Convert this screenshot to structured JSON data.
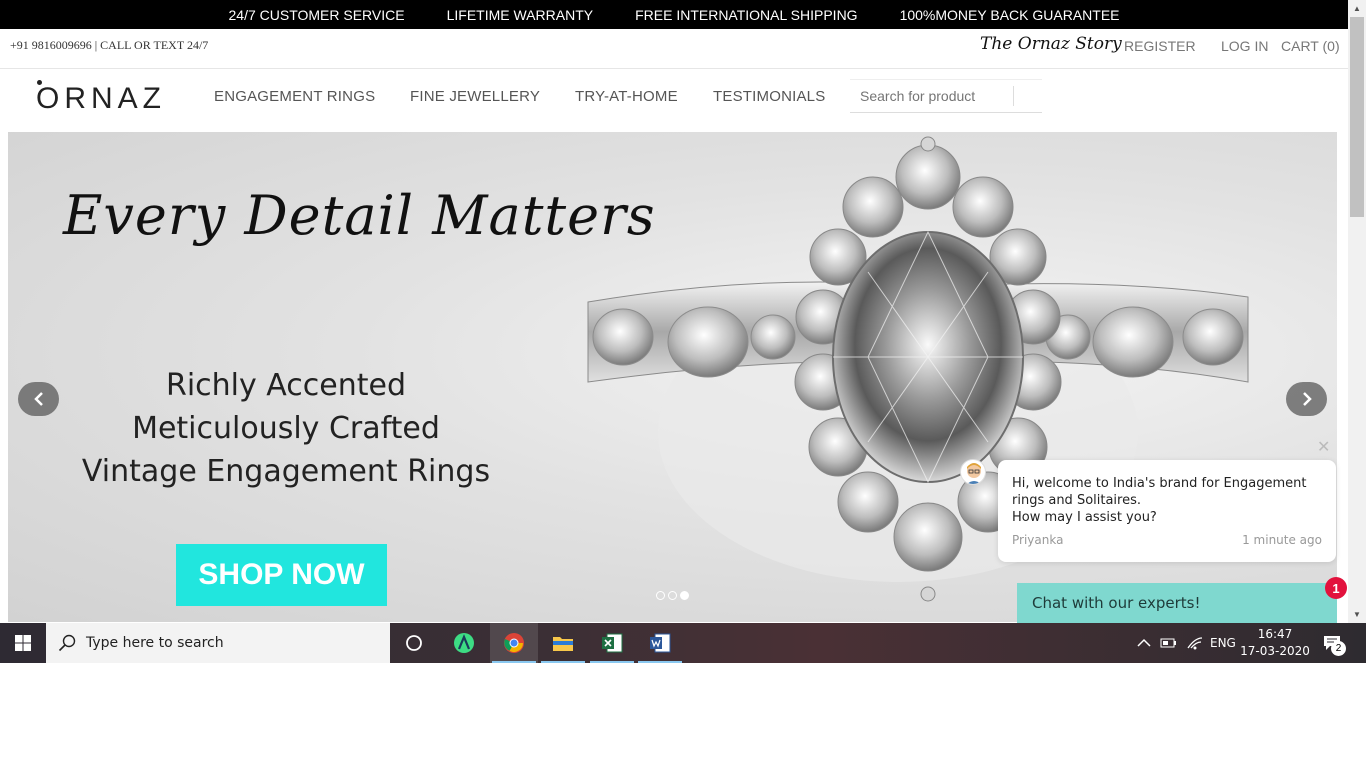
{
  "promo": {
    "items": [
      "24/7 CUSTOMER SERVICE",
      "LIFETIME WARRANTY",
      "FREE INTERNATIONAL SHIPPING",
      "100%MONEY BACK GUARANTEE"
    ]
  },
  "util": {
    "contact": "+91 9816009696 | CALL OR TEXT 24/7",
    "story": "The Ornaz Story",
    "register": "REGISTER",
    "login": "LOG IN",
    "cart": "CART (0)"
  },
  "nav": {
    "logo": "ORNAZ",
    "items": [
      "ENGAGEMENT RINGS",
      "FINE JEWELLERY",
      "TRY-AT-HOME",
      "TESTIMONIALS"
    ],
    "search_placeholder": "Search for product"
  },
  "hero": {
    "title": "Every Detail Matters",
    "line1": "Richly Accented",
    "line2": "Meticulously Crafted",
    "line3": "Vintage Engagement Rings",
    "button": "SHOP NOW",
    "slides_total": 3,
    "slide_active": 3
  },
  "chat": {
    "message_line1": "Hi, welcome to India's brand for Engagement",
    "message_line2": "rings and Solitaires.",
    "message_line3": "How may I assist you?",
    "agent": "Priyanka",
    "time": "1 minute ago",
    "button": "Chat with our experts!",
    "badge": "1",
    "accent": "#7fd8cf",
    "badge_color": "#e2123d"
  },
  "taskbar": {
    "search_placeholder": "Type here to search",
    "language": "ENG",
    "time": "16:47",
    "date": "17-03-2020",
    "notifications": "2"
  },
  "colors": {
    "shop_button": "#21e6de",
    "promo_bg": "#000000"
  }
}
